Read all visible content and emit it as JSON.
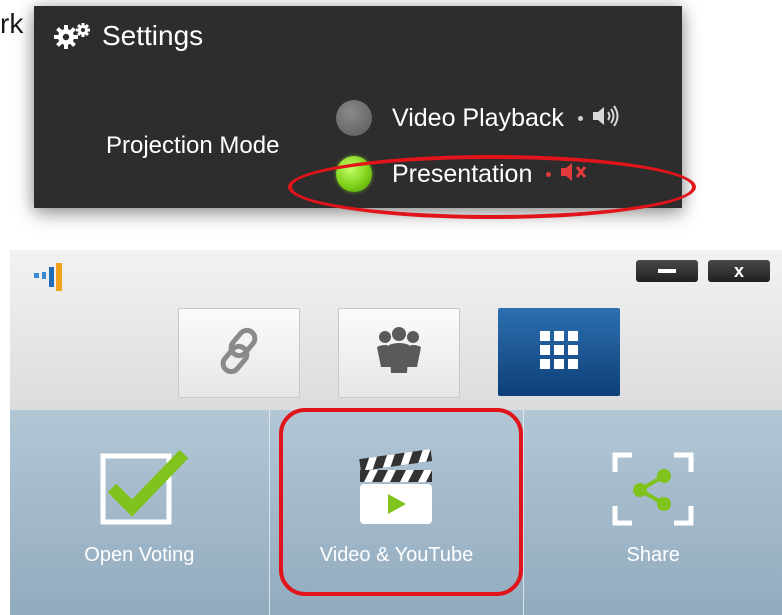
{
  "fragment_text": "rk",
  "settings": {
    "title": "Settings",
    "icon": "gear-icon",
    "projection_label": "Projection Mode",
    "options": [
      {
        "label": "Video Playback",
        "selected": false,
        "sound_icon": "speaker-icon"
      },
      {
        "label": "Presentation",
        "selected": true,
        "sound_icon": "speaker-muted-icon"
      }
    ]
  },
  "app": {
    "logo_icon": "app-logo-icon",
    "window_controls": {
      "minimize": "minimize-icon",
      "close_label": "x"
    },
    "toolbar": [
      {
        "name": "link",
        "icon": "link-icon",
        "active": false
      },
      {
        "name": "group",
        "icon": "group-icon",
        "active": false
      },
      {
        "name": "grid",
        "icon": "grid-icon",
        "active": true
      }
    ],
    "tiles": [
      {
        "label": "Open Voting",
        "icon": "voting-check-icon"
      },
      {
        "label": "Video & YouTube",
        "icon": "clapperboard-play-icon"
      },
      {
        "label": "Share",
        "icon": "share-icon"
      }
    ]
  },
  "colors": {
    "panel_bg": "#2d2d2d",
    "selected_radio": "#7fd11a",
    "highlight_red": "#e0141a",
    "tile_bg": "#a2b9ca",
    "active_tool": "#1a5592",
    "check_green": "#7fc31c"
  }
}
